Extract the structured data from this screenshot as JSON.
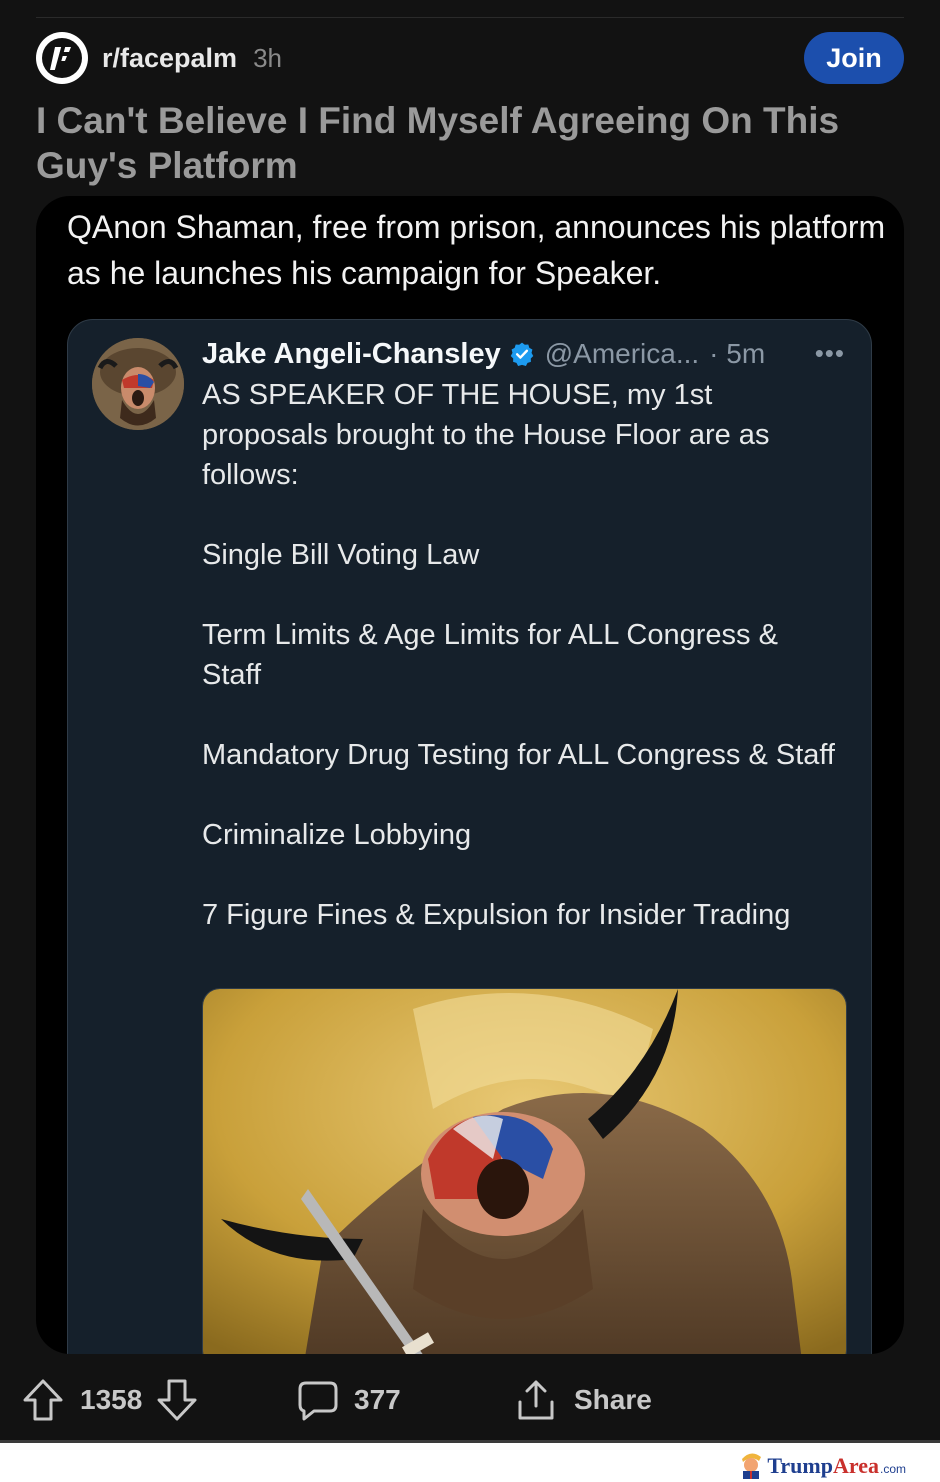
{
  "post": {
    "subreddit": "r/facepalm",
    "age": "3h",
    "join_label": "Join",
    "title": "I Can't Believe I Find Myself Agreeing On This Guy's Platform",
    "body_text": "QAnon Shaman, free from prison, announces his platform as he launches his campaign for Speaker."
  },
  "tweet": {
    "author": "Jake Angeli-Chansley",
    "handle": "@America...",
    "time": "· 5m",
    "more": "•••",
    "intro": "AS SPEAKER OF THE HOUSE, my 1st proposals brought to the House Floor are as follows:",
    "proposals": [
      "Single Bill Voting Law",
      "Term Limits & Age Limits for ALL Congress & Staff",
      "Mandatory Drug Testing for ALL Congress & Staff",
      "Criminalize Lobbying",
      "7 Figure Fines & Expulsion for Insider Trading"
    ]
  },
  "actions": {
    "upvotes": "1358",
    "comments": "377",
    "share_label": "Share"
  },
  "watermark": {
    "part1": "Trump",
    "part2": "Area",
    "suffix": ".com"
  },
  "colors": {
    "background": "#121212",
    "join_button": "#1c4fad",
    "tweet_background": "#15202b",
    "verified_badge": "#1d9bf0"
  },
  "icons": [
    "facepalm-subreddit-icon",
    "verified-badge-icon",
    "more-icon",
    "upvote-icon",
    "downvote-icon",
    "comment-icon",
    "share-icon"
  ]
}
